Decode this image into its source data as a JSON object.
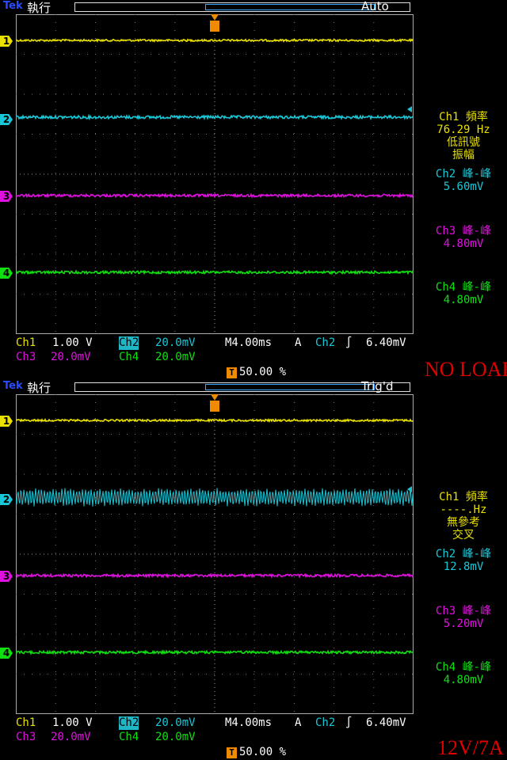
{
  "panels": [
    {
      "brand": "Tek",
      "run_state": "執行",
      "trigger_mode": "Auto",
      "channels": [
        {
          "id": "1",
          "color": "#e8e000",
          "level": 33,
          "noise": 1.2
        },
        {
          "id": "2",
          "color": "#19c8d8",
          "level": 130,
          "noise": 1.8
        },
        {
          "id": "3",
          "color": "#e010e0",
          "level": 229,
          "noise": 1.6
        },
        {
          "id": "4",
          "color": "#10e010",
          "level": 326,
          "noise": 1.6
        }
      ],
      "measurements": {
        "ch1": {
          "label": "Ch1 頻率",
          "value": "76.29 Hz",
          "note1": "低訊號",
          "note2": "振幅"
        },
        "ch2": {
          "label": "Ch2 峰-峰",
          "value": "5.60mV"
        },
        "ch3": {
          "label": "Ch3 峰-峰",
          "value": "4.80mV"
        },
        "ch4": {
          "label": "Ch4 峰-峰",
          "value": "4.80mV"
        }
      },
      "readout": {
        "ch1": "Ch1",
        "ch1_scale": "1.00 V",
        "ch2": "Ch2",
        "ch2_scale": "20.0mV",
        "timebase": "M4.00ms",
        "trig_type": "A",
        "trig_src": "Ch2",
        "trig_level": "6.40mV",
        "ch3": "Ch3",
        "ch3_scale": "20.0mV",
        "ch4": "Ch4",
        "ch4_scale": "20.0mV",
        "trig_pos": "50.00 %"
      },
      "caption": "NO LOAD"
    },
    {
      "brand": "Tek",
      "run_state": "執行",
      "trigger_mode": "Trig'd",
      "channels": [
        {
          "id": "1",
          "color": "#e8e000",
          "level": 33,
          "noise": 1.2
        },
        {
          "id": "2",
          "color": "#19c8d8",
          "level": 130,
          "noise": 12
        },
        {
          "id": "3",
          "color": "#e010e0",
          "level": 229,
          "noise": 1.6
        },
        {
          "id": "4",
          "color": "#10e010",
          "level": 326,
          "noise": 1.6
        }
      ],
      "measurements": {
        "ch1": {
          "label": "Ch1 頻率",
          "value": "----.Hz",
          "note1": "無參考",
          "note2": "交叉"
        },
        "ch2": {
          "label": "Ch2 峰-峰",
          "value": "12.8mV"
        },
        "ch3": {
          "label": "Ch3 峰-峰",
          "value": "5.20mV"
        },
        "ch4": {
          "label": "Ch4 峰-峰",
          "value": "4.80mV"
        }
      },
      "readout": {
        "ch1": "Ch1",
        "ch1_scale": "1.00 V",
        "ch2": "Ch2",
        "ch2_scale": "20.0mV",
        "timebase": "M4.00ms",
        "trig_type": "A",
        "trig_src": "Ch2",
        "trig_level": "6.40mV",
        "ch3": "Ch3",
        "ch3_scale": "20.0mV",
        "ch4": "Ch4",
        "ch4_scale": "20.0mV",
        "trig_pos": "50.00 %"
      },
      "caption": "12V/7A"
    }
  ]
}
